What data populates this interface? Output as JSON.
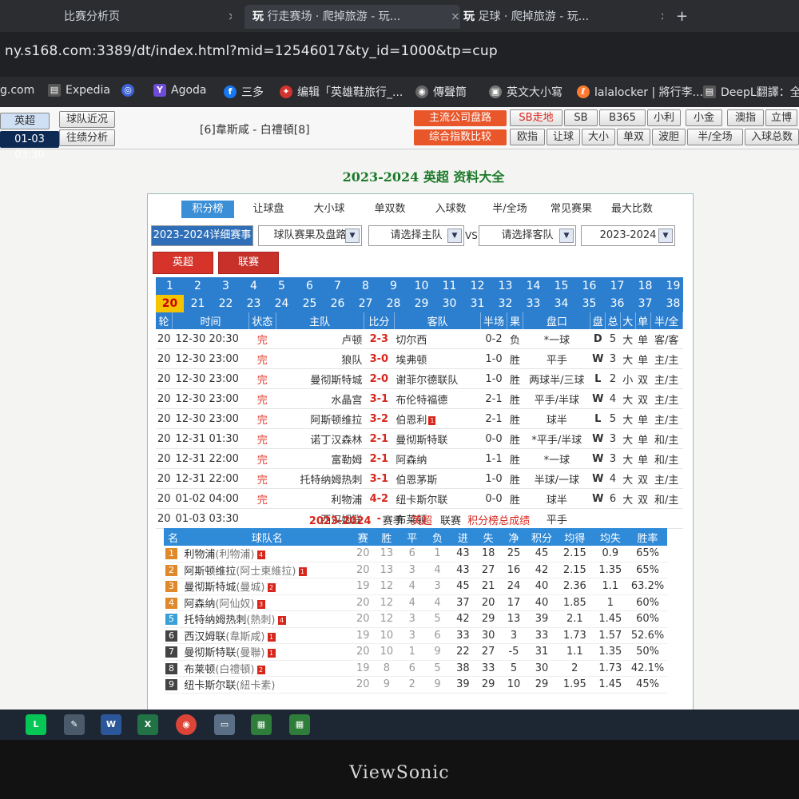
{
  "browser": {
    "tabs": [
      {
        "title": "比赛分析页"
      },
      {
        "title": "行走赛场 · 爬掉旅游 - 玩..."
      },
      {
        "title": "足球 · 爬掉旅游 - 玩..."
      }
    ],
    "new_tab": "+",
    "url": "ny.s168.com:3389/dt/index.html?mid=12546017&ty_id=1000&tp=cup",
    "bookmarks": [
      "g.com",
      "Expedia",
      "Agoda",
      "三多",
      "编辑「英雄鞋旅行_...",
      "傳聲筒",
      "英文大小寫",
      "lalalocker | 將行李...",
      "DeepL翻譯：全"
    ]
  },
  "topbar": {
    "league_btn": "英超",
    "recent_btn": "球队近况",
    "history_btn": "往绩分析",
    "datetime": "01-03 03:30",
    "matchup": "[6]韋斯咸  -  白禮頓[8]",
    "main_odds_btn": "主流公司盘路",
    "index_compare_btn": "综合指数比较",
    "odds_links_row1": [
      "SB走地",
      "SB",
      "B365",
      "小利",
      "小金",
      "澳指",
      "立博"
    ],
    "odds_links_row2": [
      "欧指",
      "让球",
      "大小",
      "单双",
      "波胆",
      "半/全场",
      "入球总数"
    ]
  },
  "header": {
    "title": "2023-2024 英超 资料大全"
  },
  "subtabs": [
    "积分榜",
    "让球盘",
    "大小球",
    "单双数",
    "入球数",
    "半/全场",
    "常见赛果",
    "最大比数"
  ],
  "filters": {
    "season_label": "2023-2024详细赛事",
    "type_select": "球队赛果及盘路",
    "home_select": "请选择主队",
    "vs": "VS",
    "away_select": "请选择客队",
    "season_select": "2023-2024"
  },
  "league_buttons": [
    "英超",
    "联赛"
  ],
  "rounds": {
    "row1": [
      "1",
      "2",
      "3",
      "4",
      "5",
      "6",
      "7",
      "8",
      "9",
      "10",
      "11",
      "12",
      "13",
      "14",
      "15",
      "16",
      "17",
      "18",
      "19"
    ],
    "row2": [
      "20",
      "21",
      "22",
      "23",
      "24",
      "25",
      "26",
      "27",
      "28",
      "29",
      "30",
      "31",
      "32",
      "33",
      "34",
      "35",
      "36",
      "37",
      "38"
    ],
    "current": "20"
  },
  "matches": {
    "headers": [
      "轮",
      "时间",
      "状态",
      "主队",
      "比分",
      "客队",
      "半场",
      "果",
      "盘口",
      "盘",
      "总",
      "大",
      "单",
      "半/全"
    ],
    "rows": [
      {
        "round": "20",
        "time": "12-30 20:30",
        "state": "完",
        "home": "卢顿",
        "score": "2-3",
        "away": "切尔西",
        "half": "0-2",
        "res": "负",
        "line": "*一球",
        "pan": "D",
        "tot": "5",
        "ou": "大",
        "oe": "单",
        "hf": "客/客",
        "red": false
      },
      {
        "round": "20",
        "time": "12-30 23:00",
        "state": "完",
        "home": "狼队",
        "score": "3-0",
        "away": "埃弗顿",
        "half": "1-0",
        "res": "胜",
        "line": "平手",
        "pan": "W",
        "tot": "3",
        "ou": "大",
        "oe": "单",
        "hf": "主/主",
        "red": false
      },
      {
        "round": "20",
        "time": "12-30 23:00",
        "state": "完",
        "home": "曼彻斯特城",
        "score": "2-0",
        "away": "谢菲尔德联队",
        "half": "1-0",
        "res": "胜",
        "line": "两球半/三球",
        "pan": "L",
        "tot": "2",
        "ou": "小",
        "oe": "双",
        "hf": "主/主",
        "red": false
      },
      {
        "round": "20",
        "time": "12-30 23:00",
        "state": "完",
        "home": "水晶宫",
        "score": "3-1",
        "away": "布伦特福德",
        "half": "2-1",
        "res": "胜",
        "line": "平手/半球",
        "pan": "W",
        "tot": "4",
        "ou": "大",
        "oe": "双",
        "hf": "主/主",
        "red": false
      },
      {
        "round": "20",
        "time": "12-30 23:00",
        "state": "完",
        "home": "阿斯顿维拉",
        "score": "3-2",
        "away": "伯恩利",
        "half": "2-1",
        "res": "胜",
        "line": "球半",
        "pan": "L",
        "tot": "5",
        "ou": "大",
        "oe": "单",
        "hf": "主/主",
        "red": true
      },
      {
        "round": "20",
        "time": "12-31 01:30",
        "state": "完",
        "home": "诺丁汉森林",
        "score": "2-1",
        "away": "曼彻斯特联",
        "half": "0-0",
        "res": "胜",
        "line": "*平手/半球",
        "pan": "W",
        "tot": "3",
        "ou": "大",
        "oe": "单",
        "hf": "和/主",
        "red": false
      },
      {
        "round": "20",
        "time": "12-31 22:00",
        "state": "完",
        "home": "富勒姆",
        "score": "2-1",
        "away": "阿森纳",
        "half": "1-1",
        "res": "胜",
        "line": "*一球",
        "pan": "W",
        "tot": "3",
        "ou": "大",
        "oe": "单",
        "hf": "和/主",
        "red": false
      },
      {
        "round": "20",
        "time": "12-31 22:00",
        "state": "完",
        "home": "托特纳姆热刺",
        "score": "3-1",
        "away": "伯恩茅斯",
        "half": "1-0",
        "res": "胜",
        "line": "半球/一球",
        "pan": "W",
        "tot": "4",
        "ou": "大",
        "oe": "双",
        "hf": "主/主",
        "red": false
      },
      {
        "round": "20",
        "time": "01-02 04:00",
        "state": "完",
        "home": "利物浦",
        "score": "4-2",
        "away": "纽卡斯尔联",
        "half": "0-0",
        "res": "胜",
        "line": "球半",
        "pan": "W",
        "tot": "6",
        "ou": "大",
        "oe": "双",
        "hf": "和/主",
        "red": false
      },
      {
        "round": "20",
        "time": "01-03 03:30",
        "state": "",
        "home": "西汉姆联",
        "score": "-",
        "away": "布莱顿",
        "half": "",
        "res": "",
        "line": "平手",
        "pan": "",
        "tot": "",
        "ou": "",
        "oe": "",
        "hf": "",
        "red": false
      }
    ]
  },
  "standings": {
    "title_season": "2023-2024",
    "title_type": "赛季",
    "title_league": "英超",
    "title_comp": "联赛",
    "title_label": "积分榜总成绩",
    "headers": [
      "名",
      "球队名",
      "赛",
      "胜",
      "平",
      "负",
      "进",
      "失",
      "净",
      "积分",
      "均得",
      "均失",
      "胜率"
    ],
    "rows": [
      {
        "rank": "1",
        "team": "利物浦",
        "alias": "(利物浦)",
        "trend": "4",
        "p": "20",
        "w": "13",
        "d": "6",
        "l": "1",
        "gf": "43",
        "ga": "18",
        "gd": "25",
        "pts": "45",
        "avgf": "2.15",
        "avga": "0.9",
        "rate": "65%",
        "color": "#e0892b"
      },
      {
        "rank": "2",
        "team": "阿斯顿维拉",
        "alias": "(阿士東維拉)",
        "trend": "1",
        "p": "20",
        "w": "13",
        "d": "3",
        "l": "4",
        "gf": "43",
        "ga": "27",
        "gd": "16",
        "pts": "42",
        "avgf": "2.15",
        "avga": "1.35",
        "rate": "65%",
        "color": "#e0892b"
      },
      {
        "rank": "3",
        "team": "曼彻斯特城",
        "alias": "(曼城)",
        "trend": "2",
        "p": "19",
        "w": "12",
        "d": "4",
        "l": "3",
        "gf": "45",
        "ga": "21",
        "gd": "24",
        "pts": "40",
        "avgf": "2.36",
        "avga": "1.1",
        "rate": "63.2%",
        "color": "#e0892b"
      },
      {
        "rank": "4",
        "team": "阿森纳",
        "alias": "(阿仙奴)",
        "trend": "3",
        "p": "20",
        "w": "12",
        "d": "4",
        "l": "4",
        "gf": "37",
        "ga": "20",
        "gd": "17",
        "pts": "40",
        "avgf": "1.85",
        "avga": "1",
        "rate": "60%",
        "color": "#e0892b"
      },
      {
        "rank": "5",
        "team": "托特纳姆热刺",
        "alias": "(熱刺)",
        "trend": "4",
        "p": "20",
        "w": "12",
        "d": "3",
        "l": "5",
        "gf": "42",
        "ga": "29",
        "gd": "13",
        "pts": "39",
        "avgf": "2.1",
        "avga": "1.45",
        "rate": "60%",
        "color": "#3aa0d8"
      },
      {
        "rank": "6",
        "team": "西汉姆联",
        "alias": "(韋斯咸)",
        "trend": "1",
        "p": "19",
        "w": "10",
        "d": "3",
        "l": "6",
        "gf": "33",
        "ga": "30",
        "gd": "3",
        "pts": "33",
        "avgf": "1.73",
        "avga": "1.57",
        "rate": "52.6%",
        "color": "#444"
      },
      {
        "rank": "7",
        "team": "曼彻斯特联",
        "alias": "(曼聯)",
        "trend": "1",
        "p": "20",
        "w": "10",
        "d": "1",
        "l": "9",
        "gf": "22",
        "ga": "27",
        "gd": "-5",
        "pts": "31",
        "avgf": "1.1",
        "avga": "1.35",
        "rate": "50%",
        "color": "#444"
      },
      {
        "rank": "8",
        "team": "布莱顿",
        "alias": "(白禮頓)",
        "trend": "2",
        "p": "19",
        "w": "8",
        "d": "6",
        "l": "5",
        "gf": "38",
        "ga": "33",
        "gd": "5",
        "pts": "30",
        "avgf": "2",
        "avga": "1.73",
        "rate": "42.1%",
        "color": "#444"
      },
      {
        "rank": "9",
        "team": "纽卡斯尔联",
        "alias": "(紐卡素)",
        "trend": "",
        "p": "20",
        "w": "9",
        "d": "2",
        "l": "9",
        "gf": "39",
        "ga": "29",
        "gd": "10",
        "pts": "29",
        "avgf": "1.95",
        "avga": "1.45",
        "rate": "45%",
        "color": "#444"
      }
    ]
  },
  "monitor": {
    "brand": "ViewSonic"
  }
}
